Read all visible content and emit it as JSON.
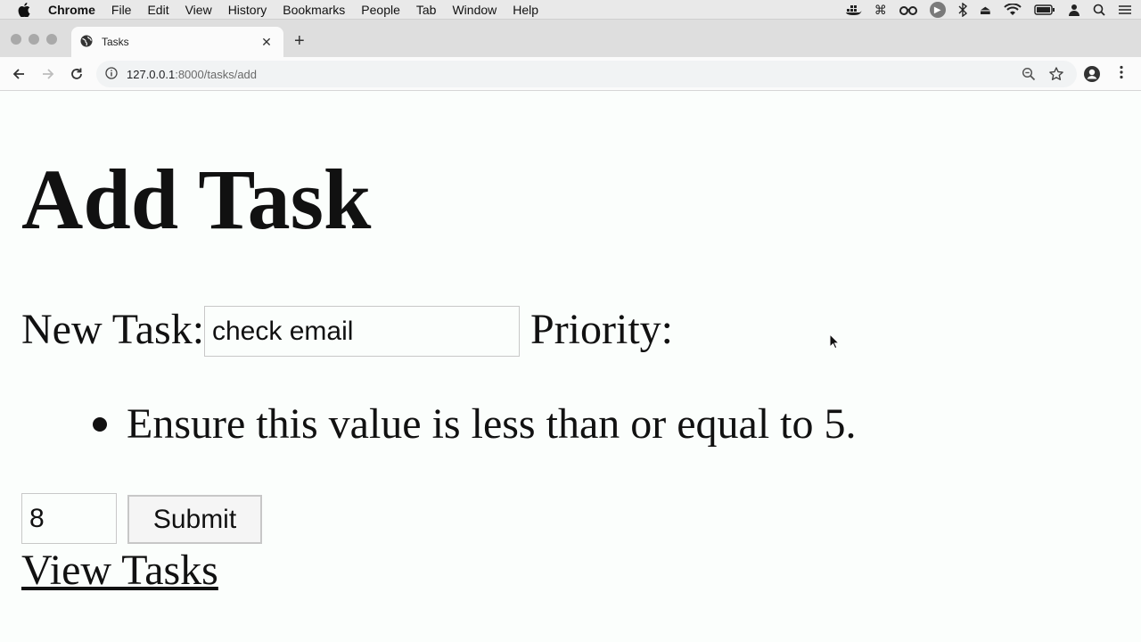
{
  "menubar": {
    "app": "Chrome",
    "items": [
      "File",
      "Edit",
      "View",
      "History",
      "Bookmarks",
      "People",
      "Tab",
      "Window",
      "Help"
    ],
    "status_icons": [
      "docker-icon",
      "command-icon",
      "glasses-icon",
      "play-icon",
      "bluetooth-icon",
      "eject-icon",
      "wifi-icon",
      "battery-icon",
      "user-icon",
      "search-icon",
      "list-icon"
    ]
  },
  "browser": {
    "tab_title": "Tasks",
    "url_host": "127.0.0.1",
    "url_rest": ":8000/tasks/add"
  },
  "page": {
    "heading": "Add Task",
    "task_label": "New Task:",
    "task_value": "check email",
    "priority_label": "Priority:",
    "errors": [
      "Ensure this value is less than or equal to 5."
    ],
    "priority_value": "8",
    "submit_label": "Submit",
    "view_link": "View Tasks"
  }
}
